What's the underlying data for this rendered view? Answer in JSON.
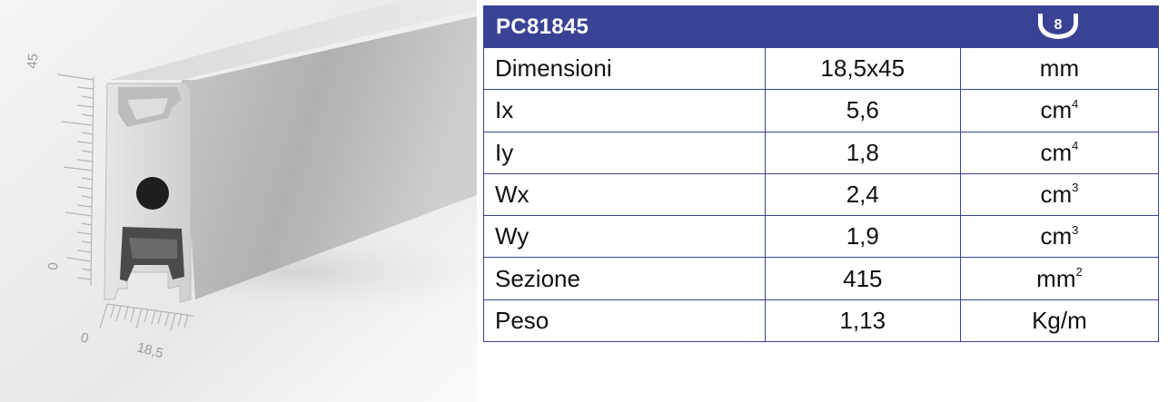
{
  "figure": {
    "scale_vertical": {
      "max_label": "45",
      "min_label": "0"
    },
    "scale_horizontal": {
      "min_label": "0",
      "max_label": "18,5"
    }
  },
  "table": {
    "code": "PC81845",
    "slot_badge": "8",
    "rows": [
      {
        "label": "Dimensioni",
        "value": "18,5x45",
        "unit": "mm",
        "unit_sup": ""
      },
      {
        "label": "Ix",
        "value": "5,6",
        "unit": "cm",
        "unit_sup": "4"
      },
      {
        "label": "Iy",
        "value": "1,8",
        "unit": "cm",
        "unit_sup": "4"
      },
      {
        "label": "Wx",
        "value": "2,4",
        "unit": "cm",
        "unit_sup": "3"
      },
      {
        "label": "Wy",
        "value": "1,9",
        "unit": "cm",
        "unit_sup": "3"
      },
      {
        "label": "Sezione",
        "value": "415",
        "unit": "mm",
        "unit_sup": "2"
      },
      {
        "label": "Peso",
        "value": "1,13",
        "unit": "Kg/m",
        "unit_sup": ""
      }
    ]
  },
  "colors": {
    "header_bg": "#3a4296",
    "border": "#3a4296",
    "text": "#111111"
  }
}
